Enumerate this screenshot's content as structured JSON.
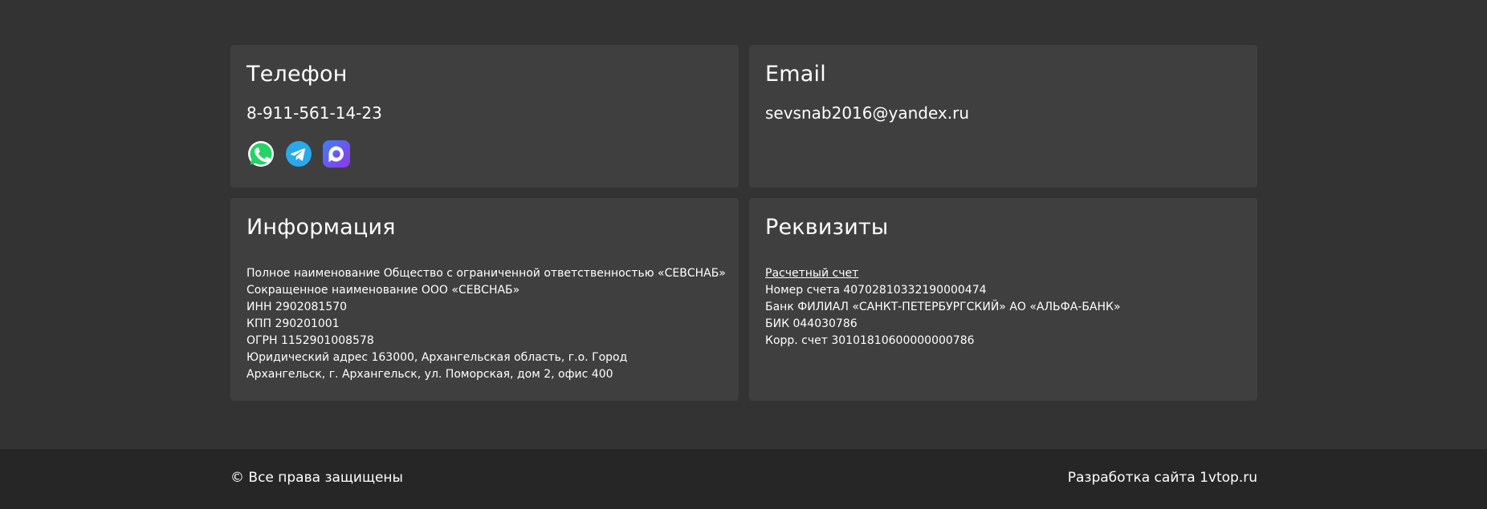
{
  "phone_card": {
    "title": "Телефон",
    "phone": "8-911-561-14-23",
    "messengers": [
      "whatsapp-icon",
      "telegram-icon",
      "max-messenger-icon"
    ]
  },
  "email_card": {
    "title": "Email",
    "email": "sevsnab2016@yandex.ru"
  },
  "info_card": {
    "title": "Информация",
    "lines": [
      "Полное наименование Общество с ограниченной ответственностью «СЕВСНАБ»",
      "Сокращенное наименование ООО «СЕВСНАБ»",
      "ИНН 2902081570",
      "КПП 290201001",
      "ОГРН 1152901008578",
      "Юридический адрес 163000, Архангельская область, г.о. Город Архангельск, г. Архангельск, ул. Поморская, дом 2, офис 400"
    ]
  },
  "requisites_card": {
    "title": "Реквизиты",
    "link": "Расчетный счет",
    "lines": [
      "Номер счета 40702810332190000474",
      "Банк ФИЛИАЛ «САНКТ-ПЕТЕРБУРГСКИЙ» АО «АЛЬФА-БАНК»",
      "БИК 044030786",
      "Корр. счет 30101810600000000786"
    ]
  },
  "footer": {
    "copyright": "© Все права защищены",
    "developer": "Разработка сайта 1vtop.ru"
  },
  "colors": {
    "page_background": "#333333",
    "card_background": "#3f3f3f",
    "footer_background": "#262626",
    "text": "#ffffff",
    "whatsapp": "#25d366",
    "telegram": "#29a9eb",
    "max_gradient_start": "#3b82f6",
    "max_gradient_end": "#9333ea"
  }
}
